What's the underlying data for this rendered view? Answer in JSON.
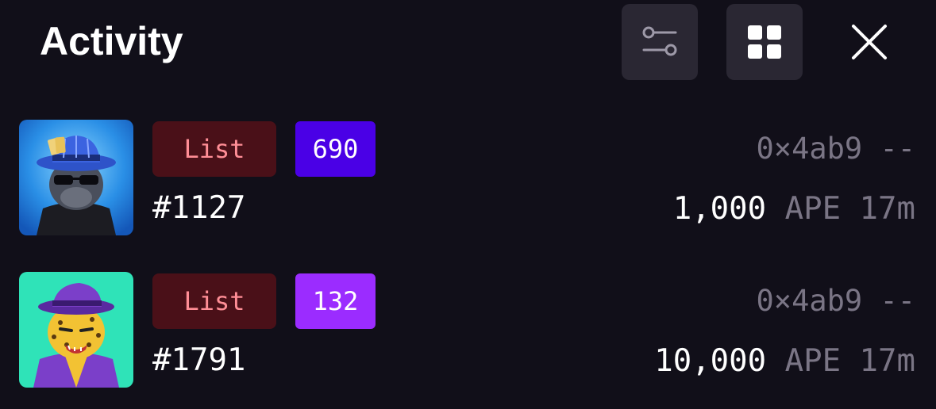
{
  "header": {
    "title": "Activity",
    "filter_icon": "sliders-icon",
    "grid_icon": "grid-view-icon",
    "close_icon": "close-icon"
  },
  "colors": {
    "background": "#110f19",
    "button_bg": "#2a2733",
    "list_badge_bg": "#4a1018",
    "list_badge_text": "#ff8e96",
    "muted_text": "#7a7585"
  },
  "activity": [
    {
      "event": "List",
      "rank": "690",
      "rank_color": "#4a00e6",
      "token_id": "#1127",
      "address": "0×4ab9 --",
      "amount": "1,000",
      "currency": "APE",
      "time": "17m"
    },
    {
      "event": "List",
      "rank": "132",
      "rank_color": "#9b2cff",
      "token_id": "#1791",
      "address": "0×4ab9 --",
      "amount": "10,000",
      "currency": "APE",
      "time": "17m"
    }
  ]
}
